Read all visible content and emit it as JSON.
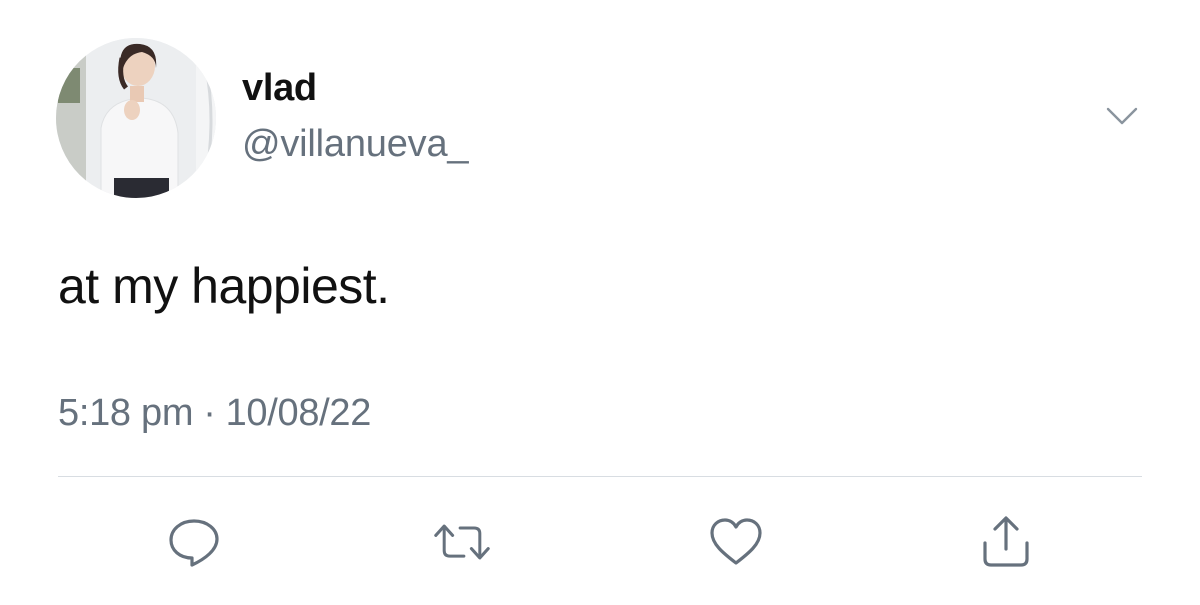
{
  "tweet": {
    "display_name": "vlad",
    "handle": "@villanueva_",
    "text": "at my happiest.",
    "time": "5:18 pm",
    "separator": "·",
    "date": "10/08/22"
  },
  "icons": {
    "menu": "chevron-down-icon",
    "reply": "reply-icon",
    "retweet": "retweet-icon",
    "like": "heart-icon",
    "share": "share-icon"
  },
  "colors": {
    "text": "#111111",
    "secondary": "#66717d",
    "icon": "#66717d",
    "divider": "#d8dde2",
    "background": "#ffffff"
  }
}
